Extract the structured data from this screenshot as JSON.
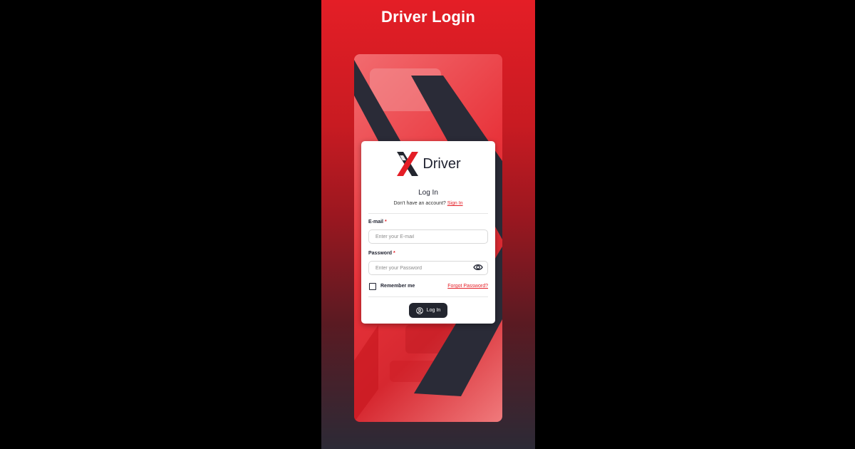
{
  "header": {
    "title": "Driver Login"
  },
  "brand": {
    "name": "Driver",
    "logo_icon": "x-logo-icon"
  },
  "login": {
    "heading": "Log In",
    "no_account_text": "Don't have an account?",
    "signup_link": "Sign In"
  },
  "form": {
    "email_label": "E-mail",
    "email_placeholder": "Enter your E-mail",
    "email_value": "",
    "password_label": "Password",
    "password_placeholder": "Enter your Password",
    "password_value": "",
    "required_marker": "*",
    "remember_label": "Remember me",
    "remember_checked": false,
    "forgot_link": "Forgot Password?",
    "submit_label": "Log In"
  },
  "icons": {
    "password_toggle": "eye-icon",
    "submit": "user-circle-icon"
  },
  "colors": {
    "accent": "#e41e26",
    "dark": "#23262f",
    "card": "#ffffff"
  }
}
